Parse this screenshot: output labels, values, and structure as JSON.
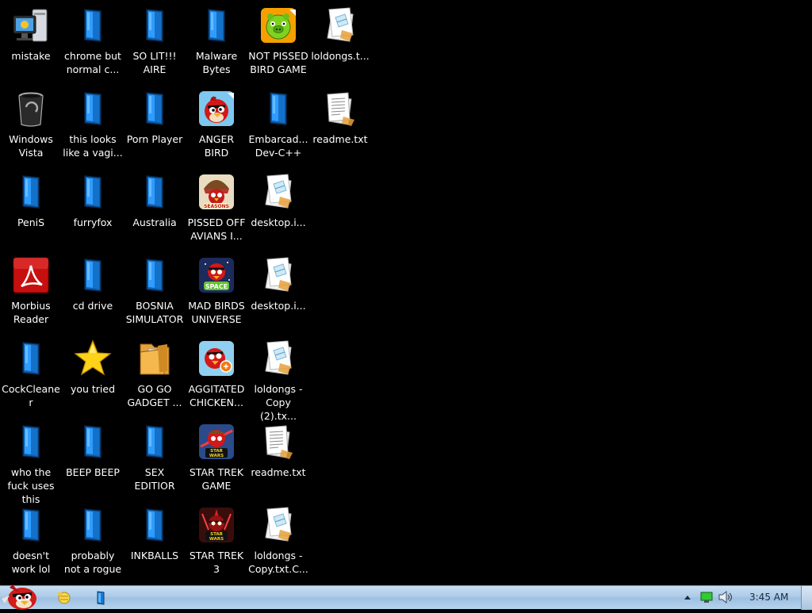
{
  "desktop": {
    "columns": [
      [
        {
          "label": "mistake",
          "icon": "computer-monitor-icon"
        },
        {
          "label": "Windows Vista",
          "icon": "recycle-bin-icon"
        },
        {
          "label": "PeniS",
          "icon": "blue-app-icon"
        },
        {
          "label": "Morbius Reader",
          "icon": "pdf-reader-icon"
        },
        {
          "label": "CockCleaner",
          "icon": "blue-app-icon"
        },
        {
          "label": "who the fuck uses this",
          "icon": "blue-app-icon"
        },
        {
          "label": "doesn't work lol",
          "icon": "blue-app-icon"
        }
      ],
      [
        {
          "label": "chrome but normal c...",
          "icon": "blue-app-icon"
        },
        {
          "label": "this looks like a vagi...",
          "icon": "blue-app-icon"
        },
        {
          "label": "furryfox",
          "icon": "blue-app-icon"
        },
        {
          "label": "cd drive",
          "icon": "blue-app-icon"
        },
        {
          "label": "you tried",
          "icon": "star-icon"
        },
        {
          "label": "BEEP BEEP",
          "icon": "blue-app-icon"
        },
        {
          "label": "probably not a rogue",
          "icon": "blue-app-icon"
        }
      ],
      [
        {
          "label": "SO LIT!!! AIRE",
          "icon": "blue-app-icon"
        },
        {
          "label": "Porn Player",
          "icon": "blue-app-icon"
        },
        {
          "label": "Australia",
          "icon": "blue-app-icon"
        },
        {
          "label": "BOSNIA SIMULATOR",
          "icon": "blue-app-icon"
        },
        {
          "label": "GO GO GADGET ...",
          "icon": "folder-icon"
        },
        {
          "label": "SEX EDITIOR",
          "icon": "blue-app-icon"
        },
        {
          "label": "INKBALLS",
          "icon": "blue-app-icon"
        }
      ],
      [
        {
          "label": "Malware Bytes",
          "icon": "blue-app-icon"
        },
        {
          "label": "ANGER BIRD",
          "icon": "angry-bird-red-icon"
        },
        {
          "label": "PISSED OFF AVIANS I...",
          "icon": "angry-birds-seasons-icon"
        },
        {
          "label": "MAD BIRDS UNIVERSE",
          "icon": "angry-birds-space-icon"
        },
        {
          "label": "AGGITATED CHICKEN...",
          "icon": "angry-bird-chicken-icon"
        },
        {
          "label": "STAR TREK GAME",
          "icon": "angry-birds-star-wars-icon"
        },
        {
          "label": "STAR TREK 3",
          "icon": "angry-birds-star-wars-2-icon"
        }
      ],
      [
        {
          "label": "NOT PISSED BIRD GAME",
          "icon": "green-pig-icon"
        },
        {
          "label": "Embarcad... Dev-C++",
          "icon": "blue-app-icon"
        },
        {
          "label": "desktop.i...",
          "icon": "text-file-icon"
        },
        {
          "label": "desktop.i...",
          "icon": "text-file-icon"
        },
        {
          "label": "loldongs - Copy (2).tx...",
          "icon": "text-file-icon"
        },
        {
          "label": "readme.txt",
          "icon": "document-icon"
        },
        {
          "label": "loldongs - Copy.txt.C...",
          "icon": "text-file-icon"
        }
      ],
      [
        {
          "label": "loldongs.t...",
          "icon": "text-file-icon"
        },
        {
          "label": "readme.txt",
          "icon": "document-icon"
        }
      ]
    ]
  },
  "taskbar": {
    "start_icon": "angry-bird-start-orb-icon",
    "pinned": [
      {
        "name": "explorer-icon"
      },
      {
        "name": "blue-app-icon"
      }
    ],
    "tray": {
      "arrow_icon": "show-hidden-icons-arrow",
      "network_icon": "network-icon",
      "volume_icon": "volume-icon",
      "clock": "3:45 AM"
    }
  },
  "colors": {
    "desktop_bg": "#000000",
    "taskbar_bg": "#b7d2ec",
    "label_text": "#ffffff",
    "clock_text": "#1a2a3a"
  }
}
